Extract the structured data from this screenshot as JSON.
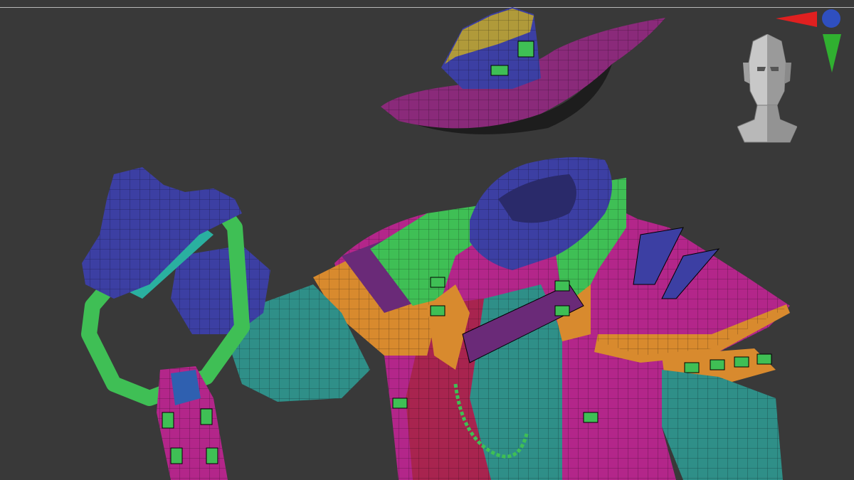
{
  "viewport": {
    "label": "3D viewport",
    "background": "#393939"
  },
  "model": {
    "description_icon": "sculpt-mesh-polygroups",
    "polygroup_colors": {
      "blue": "#3c3fa3",
      "green": "#3fbf55",
      "teal": "#2f8f88",
      "magenta": "#b3268a",
      "purple": "#6a2a78",
      "orange": "#d88a2e",
      "gold": "#b09a3a",
      "crimson": "#a8244f"
    }
  },
  "gizmo": {
    "x_axis_color": "#e02020",
    "y_axis_color": "#30b030",
    "z_axis_color": "#2f4fc0",
    "icon": "axis-gizmo-icon"
  },
  "navigation": {
    "icon": "head-navigation-icon"
  }
}
